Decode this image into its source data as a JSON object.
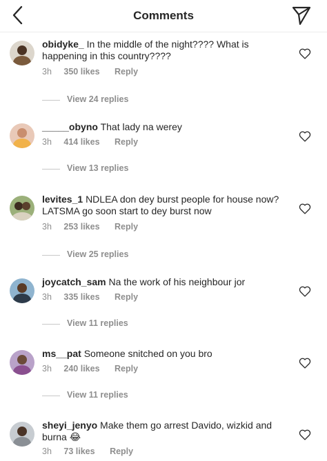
{
  "header": {
    "title": "Comments",
    "back_icon": "chevron-left-icon",
    "share_icon": "paper-plane-icon"
  },
  "comments": [
    {
      "username": "obidyke_",
      "text": "In the middle of the night???? What is happening in this country????",
      "time": "3h",
      "likes": "350 likes",
      "reply": "Reply",
      "view_replies": "View 24 replies"
    },
    {
      "username": "_____obyno",
      "text": "That lady na werey",
      "time": "3h",
      "likes": "414 likes",
      "reply": "Reply",
      "view_replies": "View 13 replies"
    },
    {
      "username": "levites_1",
      "text": "NDLEA don dey burst people for house now? LATSMA go soon start to dey burst now",
      "time": "3h",
      "likes": "253 likes",
      "reply": "Reply",
      "view_replies": "View 25 replies"
    },
    {
      "username": "joycatch_sam",
      "text": "Na the work of his neighbour jor",
      "time": "3h",
      "likes": "335 likes",
      "reply": "Reply",
      "view_replies": "View 11 replies"
    },
    {
      "username": "ms__pat",
      "text": "Someone snitched on you bro",
      "time": "3h",
      "likes": "240 likes",
      "reply": "Reply",
      "view_replies": "View 11 replies"
    },
    {
      "username": "sheyi_jenyo",
      "text": "Make them go arrest Davido, wizkid and burna 😂",
      "time": "3h",
      "likes": "73 likes",
      "reply": "Reply"
    }
  ],
  "colors": {
    "primary_text": "#262626",
    "secondary_text": "#8e8e8e",
    "divider": "#ececec"
  }
}
